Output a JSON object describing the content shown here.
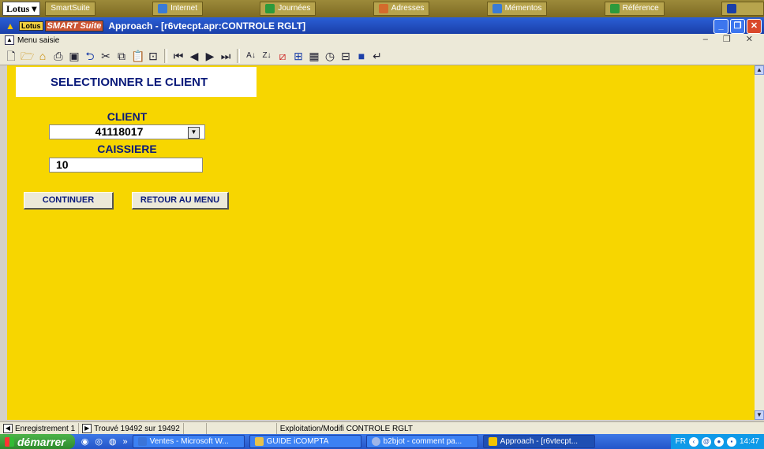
{
  "suitebar": {
    "lotus": "Lotus",
    "items": [
      {
        "label": "SmartSuite",
        "color": "#d8c970"
      },
      {
        "label": "Internet",
        "color": "#3a7bd5"
      },
      {
        "label": "Journées",
        "color": "#2c9a3c"
      },
      {
        "label": "Adresses",
        "color": "#d36b2c"
      },
      {
        "label": "Mémentos",
        "color": "#3a7bd5"
      },
      {
        "label": "Référence",
        "color": "#2c9a3c"
      }
    ]
  },
  "window": {
    "logo": "Lotus",
    "suite": "SMART Suite",
    "title": "Approach - [r6vtecpt.apr:CONTROLE RGLT]",
    "minimize": "_",
    "restore": "❐",
    "close": "✕"
  },
  "menubar": {
    "label": "Menu saisie",
    "mdi": "– ❐ ✕"
  },
  "toolbar": {
    "icons": [
      "new",
      "open",
      "open-folder",
      "print",
      "preview",
      "undo",
      "cut",
      "copy",
      "paste",
      "find",
      "first",
      "prev",
      "next",
      "last",
      "sort-asc",
      "sort-desc",
      "query",
      "find-sort",
      "date",
      "time",
      "form",
      "db",
      "enter"
    ]
  },
  "form": {
    "heading": "SELECTIONNER LE CLIENT",
    "client_label": "CLIENT",
    "client_value": "41118017",
    "dropdown_glyph": "▼",
    "caissiere_label": "CAISSIERE",
    "caissiere_value": "10",
    "continue_button": "CONTINUER",
    "menu_button": "RETOUR AU MENU",
    "background": "#f7d600"
  },
  "statusbar": {
    "record": "Enregistrement 1",
    "found": "Trouvé 19492 sur 19492",
    "view": "Exploitation/Modifi CONTROLE RGLT"
  },
  "taskbar": {
    "start": "démarrer",
    "tasks": [
      {
        "label": "Ventes - Microsoft W...",
        "color": "#3b74d9"
      },
      {
        "label": "GUIDE iCOMPTA",
        "color": "#e8c24a"
      },
      {
        "label": "b2bjot - comment pa...",
        "color": "#9fb6e8"
      },
      {
        "label": "Approach - [r6vtecpt...",
        "color": "#f3c400"
      }
    ],
    "lang": "FR",
    "time": "14:47"
  }
}
